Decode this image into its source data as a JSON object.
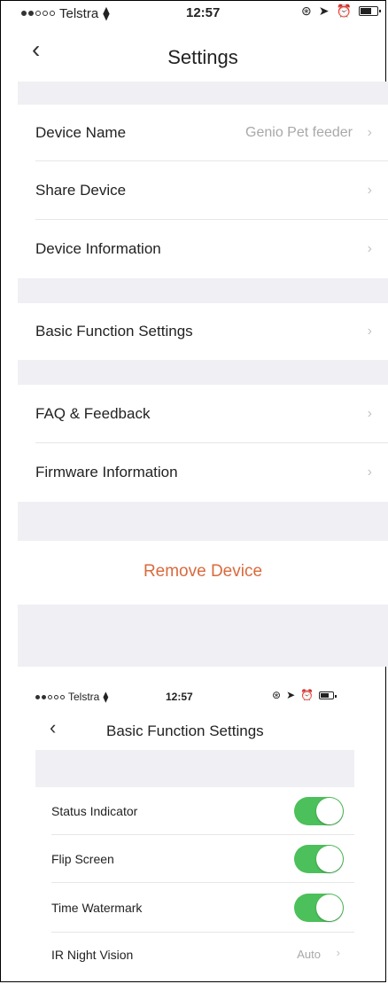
{
  "screen1": {
    "status_bar": {
      "carrier": "Telstra",
      "time": "12:57"
    },
    "title": "Settings",
    "back_icon": "chevron-left-icon",
    "rows": [
      {
        "label": "Device Name",
        "value": "Genio Pet feeder"
      },
      {
        "label": "Share Device"
      },
      {
        "label": "Device Information"
      },
      {
        "label": "Basic Function Settings"
      },
      {
        "label": "FAQ & Feedback"
      },
      {
        "label": "Firmware Information"
      }
    ],
    "remove_label": "Remove Device"
  },
  "screen2": {
    "status_bar": {
      "carrier": "Telstra",
      "time": "12:57"
    },
    "title": "Basic Function Settings",
    "rows": [
      {
        "label": "Status Indicator",
        "toggle": true
      },
      {
        "label": "Flip Screen",
        "toggle": true
      },
      {
        "label": "Time Watermark",
        "toggle": true
      },
      {
        "label": "IR Night Vision",
        "value": "Auto"
      }
    ]
  },
  "colors": {
    "accent_remove": "#d86a3c",
    "toggle_on": "#4cc05a",
    "group_bg": "#efeff4"
  }
}
